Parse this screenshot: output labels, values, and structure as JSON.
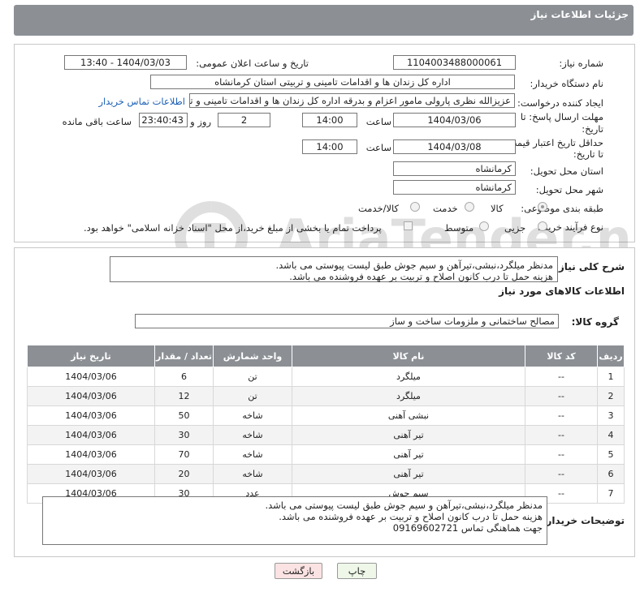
{
  "header": {
    "title": "جزئیات اطلاعات نیاز"
  },
  "form": {
    "need_number_label": "شماره نیاز:",
    "need_number": "1104003488000061",
    "announce_label": "تاریخ و ساعت اعلان عمومی:",
    "announce_value": "1404/03/03 - 13:40",
    "buyer_org_label": "نام دستگاه خریدار:",
    "buyer_org": "اداره کل زندان ها و اقدامات تامینی و تربیتی استان کرمانشاه",
    "creator_label": "ایجاد کننده درخواست:",
    "creator": "عزیزالله نظری پارولی مامور اعزام و بدرقه اداره کل زندان ها و اقدامات تامینی و تربیتی",
    "contact_link": "اطلاعات تماس خریدار",
    "deadline_label_1": "مهلت ارسال پاسخ: تا",
    "deadline_label_2": "تاریخ:",
    "deadline_date": "1404/03/06",
    "time_label": "ساعت",
    "deadline_time": "14:00",
    "days_value": "2",
    "days_label": "روز و",
    "remaining_time": "23:40:43",
    "remaining_label": "ساعت باقی مانده",
    "min_validity_label_1": "حداقل تاریخ اعتبار قیمت:",
    "min_validity_label_2": "تا تاریخ:",
    "validity_date": "1404/03/08",
    "validity_time": "14:00",
    "province_label": "استان محل تحویل:",
    "province": "کرمانشاه",
    "city_label": "شهر محل تحویل:",
    "city": "کرمانشاه",
    "category_label": "طبقه بندی موضوعی:",
    "category_options": [
      "کالا",
      "خدمت",
      "کالا/خدمت"
    ],
    "process_label": "نوع فرآیند خرید :",
    "process_options": [
      "جزیی",
      "متوسط"
    ],
    "payment_note": "پرداخت تمام یا بخشی از مبلغ خرید،از محل \"اسناد خزانه اسلامی\" خواهد بود."
  },
  "description": {
    "label": "شرح کلی نیاز:",
    "line1": "مدنظر میلگرد،نبشی،تیرآهن و سیم جوش طبق لیست پیوستی می باشد.",
    "line2": "هزینه حمل تا درب کانون اصلاح و تربیت بر عهده فروشنده می باشد."
  },
  "goods": {
    "section_title": "اطلاعات کالاهای مورد نیاز",
    "group_label": "گروه کالا:",
    "group_value": "مصالح ساختمانی و ملزومات ساخت و ساز",
    "columns": [
      "ردیف",
      "کد کالا",
      "نام کالا",
      "واحد شمارش",
      "تعداد / مقدار",
      "تاریخ نیاز"
    ],
    "rows": [
      [
        "1",
        "--",
        "میلگرد",
        "تن",
        "6",
        "1404/03/06"
      ],
      [
        "2",
        "--",
        "میلگرد",
        "تن",
        "12",
        "1404/03/06"
      ],
      [
        "3",
        "--",
        "نبشی آهنی",
        "شاخه",
        "50",
        "1404/03/06"
      ],
      [
        "4",
        "--",
        "تیر آهنی",
        "شاخه",
        "30",
        "1404/03/06"
      ],
      [
        "5",
        "--",
        "تیر آهنی",
        "شاخه",
        "70",
        "1404/03/06"
      ],
      [
        "6",
        "--",
        "تیر آهنی",
        "شاخه",
        "20",
        "1404/03/06"
      ],
      [
        "7",
        "--",
        "سیم جوش",
        "عدد",
        "30",
        "1404/03/06"
      ]
    ]
  },
  "buyer_notes": {
    "label": "توضیحات خریدار:",
    "line1": "مدنظر میلگرد،نبشی،تیرآهن و سیم جوش طبق لیست پیوستی می باشد.",
    "line2": "هزینه حمل تا درب کانون اصلاح و تربیت بر عهده فروشنده می باشد.",
    "line3": "جهت هماهنگی تماس 09169602721"
  },
  "buttons": {
    "print": "چاپ",
    "back": "بازگشت"
  },
  "watermark": {
    "text": "AriaTender.neT"
  }
}
